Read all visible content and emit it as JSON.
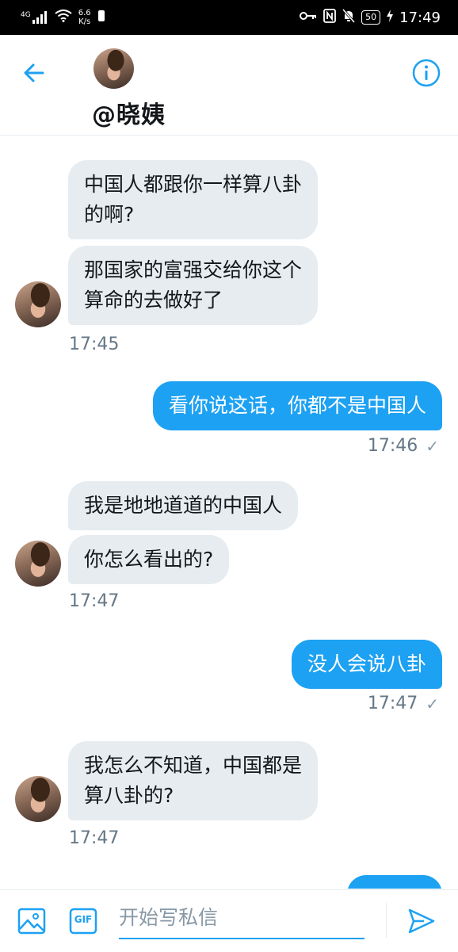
{
  "status_bar": {
    "network": "4G",
    "speed_value": "6.6",
    "speed_unit": "K/s",
    "battery": "50",
    "time": "17:49"
  },
  "header": {
    "username": "@晓姨"
  },
  "messages": [
    {
      "dir": "in",
      "text": "中国人都跟你一样算八卦\n的啊?"
    },
    {
      "dir": "in",
      "text": "那国家的富强交给你这个\n算命的去做好了"
    },
    {
      "dir": "ts_in",
      "text": "17:45"
    },
    {
      "dir": "out",
      "text": "看你说这话，你都不是中国人"
    },
    {
      "dir": "ts_out",
      "text": "17:46"
    },
    {
      "dir": "in",
      "text": "我是地地道道的中国人"
    },
    {
      "dir": "in",
      "text": "你怎么看出的?"
    },
    {
      "dir": "ts_in",
      "text": "17:47"
    },
    {
      "dir": "out",
      "text": "没人会说八卦"
    },
    {
      "dir": "ts_out",
      "text": "17:47"
    },
    {
      "dir": "in",
      "text": "我怎么不知道，中国都是\n算八卦的?"
    },
    {
      "dir": "ts_in",
      "text": "17:47"
    }
  ],
  "composer": {
    "placeholder": "开始写私信",
    "gif_label": "GIF"
  },
  "colors": {
    "accent": "#1da1f2",
    "incoming_bubble": "#e6ecf0",
    "timestamp": "#657786"
  },
  "icons": {
    "back": "arrow-left-icon",
    "info": "info-icon",
    "image": "image-icon",
    "gif": "gif-icon",
    "send": "send-icon"
  }
}
